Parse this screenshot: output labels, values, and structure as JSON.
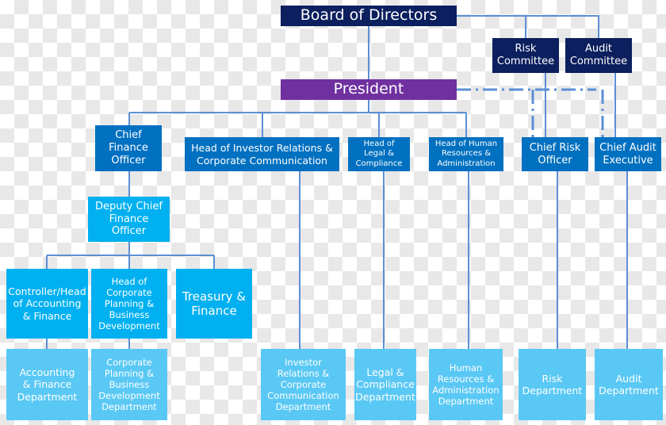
{
  "colors": {
    "board": "#0c1f5e",
    "president": "#7030a0",
    "executive": "#0070c0",
    "deputy": "#00b0f0",
    "department": "#5ac8f4",
    "connector": "#5b8fd6"
  },
  "board": "Board of Directors",
  "committees": {
    "risk": "Risk\nCommittee",
    "audit": "Audit\nCommittee"
  },
  "president": "President",
  "executives": {
    "cfo": "Chief\nFinance\nOfficer",
    "investor": "Head of Investor Relations  &\nCorporate Communication",
    "legal": "Head of\nLegal &\nCompliance",
    "hr": "Head of  Human\nResources &\nAdministration",
    "cro": "Chief Risk\nOfficer",
    "cae": "Chief Audit\nExecutive"
  },
  "deputy_cfo": "Deputy Chief\nFinance\nOfficer",
  "finance_units": {
    "controller": "Controller/Head\nof Accounting\n& Finance",
    "corp_planning": "Head of\nCorporate\nPlanning &\nBusiness\nDevelopment",
    "treasury": "Treasury &\nFinance"
  },
  "departments": {
    "accounting": "Accounting\n& Finance\nDepartment",
    "corp_planning": "Corporate\nPlanning &\nBusiness\nDevelopment\nDepartment",
    "investor": "Investor\nRelations &\nCorporate\nCommunication\nDepartment",
    "legal": "Legal &\nCompliance\nDepartment",
    "hr": "Human\nResources &\nAdministration\nDepartment",
    "risk": "Risk\nDepartment",
    "audit": "Audit\nDepartment"
  }
}
